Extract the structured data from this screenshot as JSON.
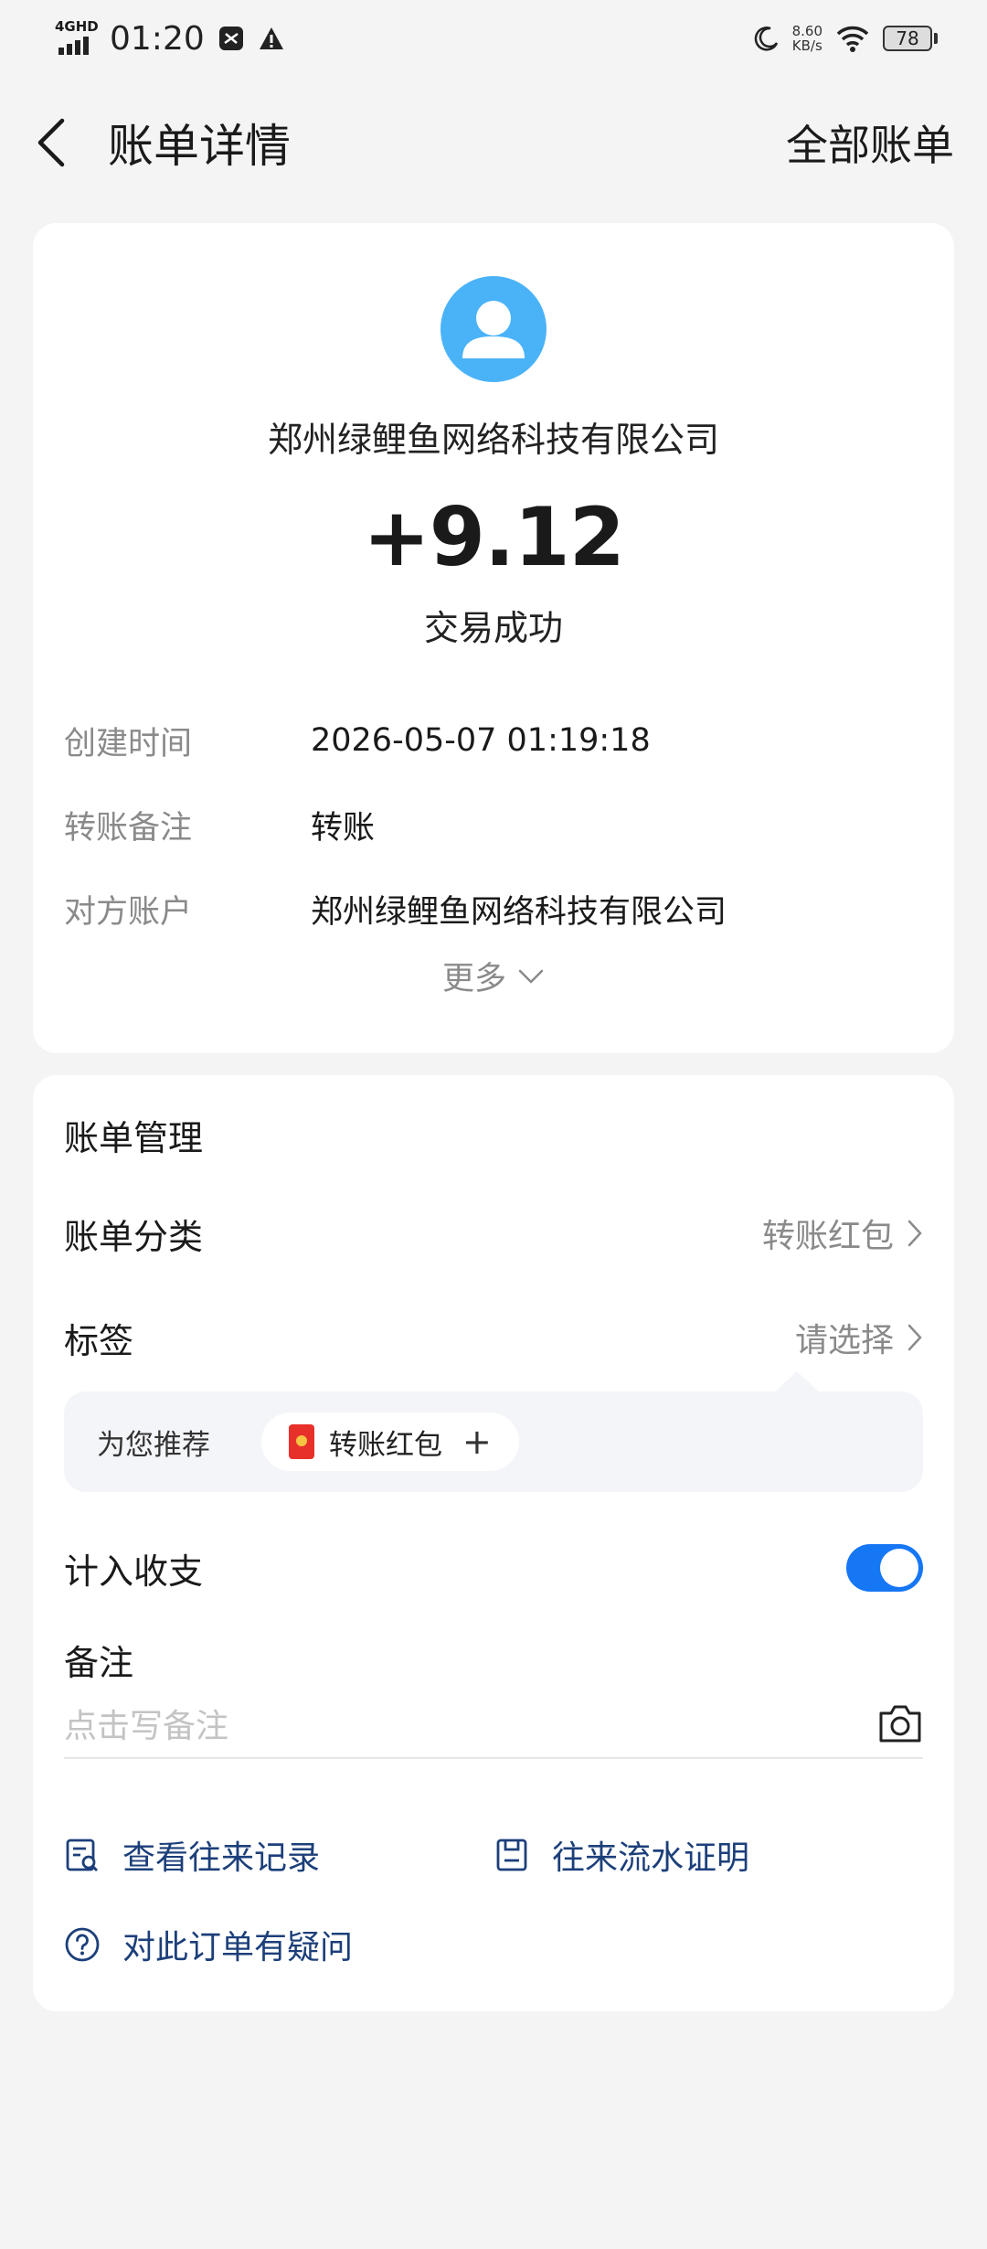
{
  "status_bar": {
    "network": "4GHD",
    "time": "01:20",
    "net_speed_value": "8.60",
    "net_speed_unit": "KB/s",
    "battery": "78"
  },
  "nav": {
    "title": "账单详情",
    "right_label": "全部账单"
  },
  "transaction": {
    "counterparty": "郑州绿鲤鱼网络科技有限公司",
    "amount": "+9.12",
    "status": "交易成功",
    "details": [
      {
        "label": "创建时间",
        "value": "2026-05-07 01:19:18"
      },
      {
        "label": "转账备注",
        "value": "转账"
      },
      {
        "label": "对方账户",
        "value": "郑州绿鲤鱼网络科技有限公司"
      }
    ],
    "more_label": "更多"
  },
  "management": {
    "title": "账单管理",
    "category_label": "账单分类",
    "category_value": "转账红包",
    "tag_label": "标签",
    "tag_value": "请选择",
    "recommend_label": "为您推荐",
    "recommend_chip": "转账红包",
    "include_label": "计入收支",
    "include_enabled": true,
    "note_label": "备注",
    "note_placeholder": "点击写备注",
    "links": {
      "records": "查看往来记录",
      "proof": "往来流水证明",
      "question": "对此订单有疑问"
    }
  },
  "colors": {
    "accent": "#1677f5",
    "link": "#1c3f7a",
    "avatar": "#4ab3f8",
    "background": "#f4f4f4"
  }
}
